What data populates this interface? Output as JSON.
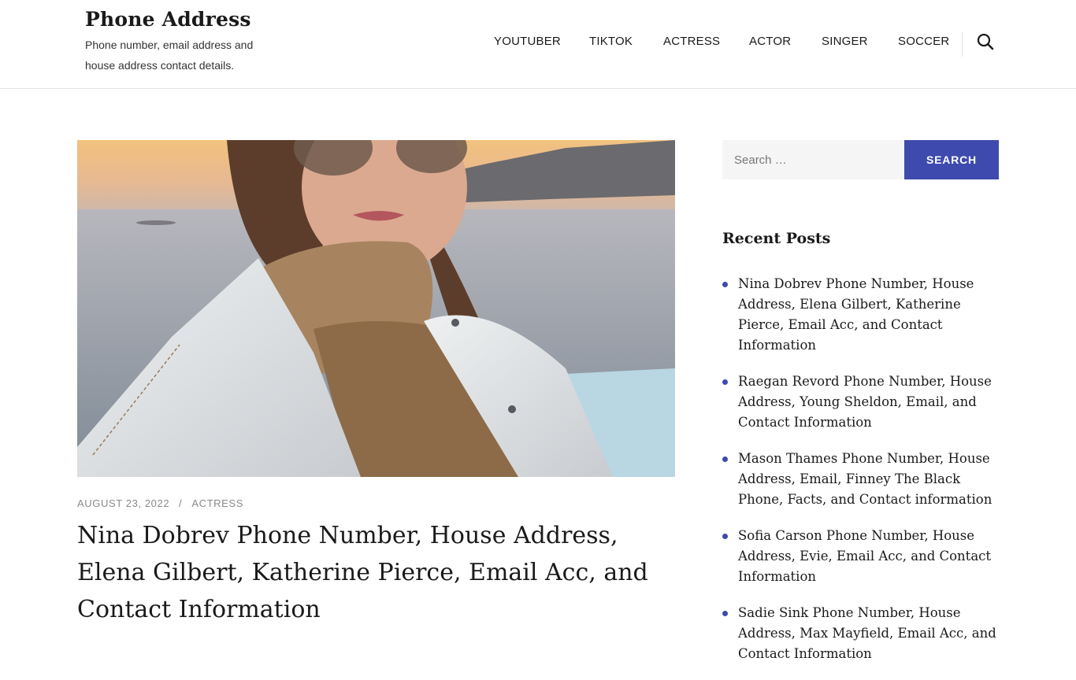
{
  "site": {
    "title": "Phone Address",
    "description": "Phone number, email address and house address contact details."
  },
  "nav": {
    "items": [
      {
        "label": "YOUTUBER"
      },
      {
        "label": "TIKTOK"
      },
      {
        "label": "ACTRESS"
      },
      {
        "label": "ACTOR"
      },
      {
        "label": "SINGER"
      },
      {
        "label": "SOCCER"
      }
    ],
    "search_icon": "search-icon"
  },
  "post": {
    "image": "featured-photo",
    "date": "AUGUST 23, 2022",
    "separator": "/",
    "category": "ACTRESS",
    "title": "Nina Dobrev Phone Number, House Address, Elena Gilbert, Katherine Pierce, Email Acc, and Contact Information"
  },
  "sidebar": {
    "search": {
      "placeholder": "Search …",
      "button_label": "SEARCH"
    },
    "recent_posts": {
      "title": "Recent Posts",
      "items": [
        {
          "title": "Nina Dobrev Phone Number, House Address, Elena Gilbert, Katherine Pierce, Email Acc, and Contact Information"
        },
        {
          "title": "Raegan Revord Phone Number, House Address, Young Sheldon, Email, and Contact Information"
        },
        {
          "title": "Mason Thames Phone Number, House Address, Email, Finney The Black Phone, Facts, and Contact information"
        },
        {
          "title": "Sofia Carson Phone Number, House Address, Evie, Email Acc, and Contact Information"
        },
        {
          "title": "Sadie Sink Phone Number, House Address, Max Mayfield, Email Acc, and Contact Information"
        }
      ]
    }
  },
  "colors": {
    "accent": "#3f4aaf",
    "text": "#1a1a1a",
    "meta": "#8a8a8a"
  }
}
